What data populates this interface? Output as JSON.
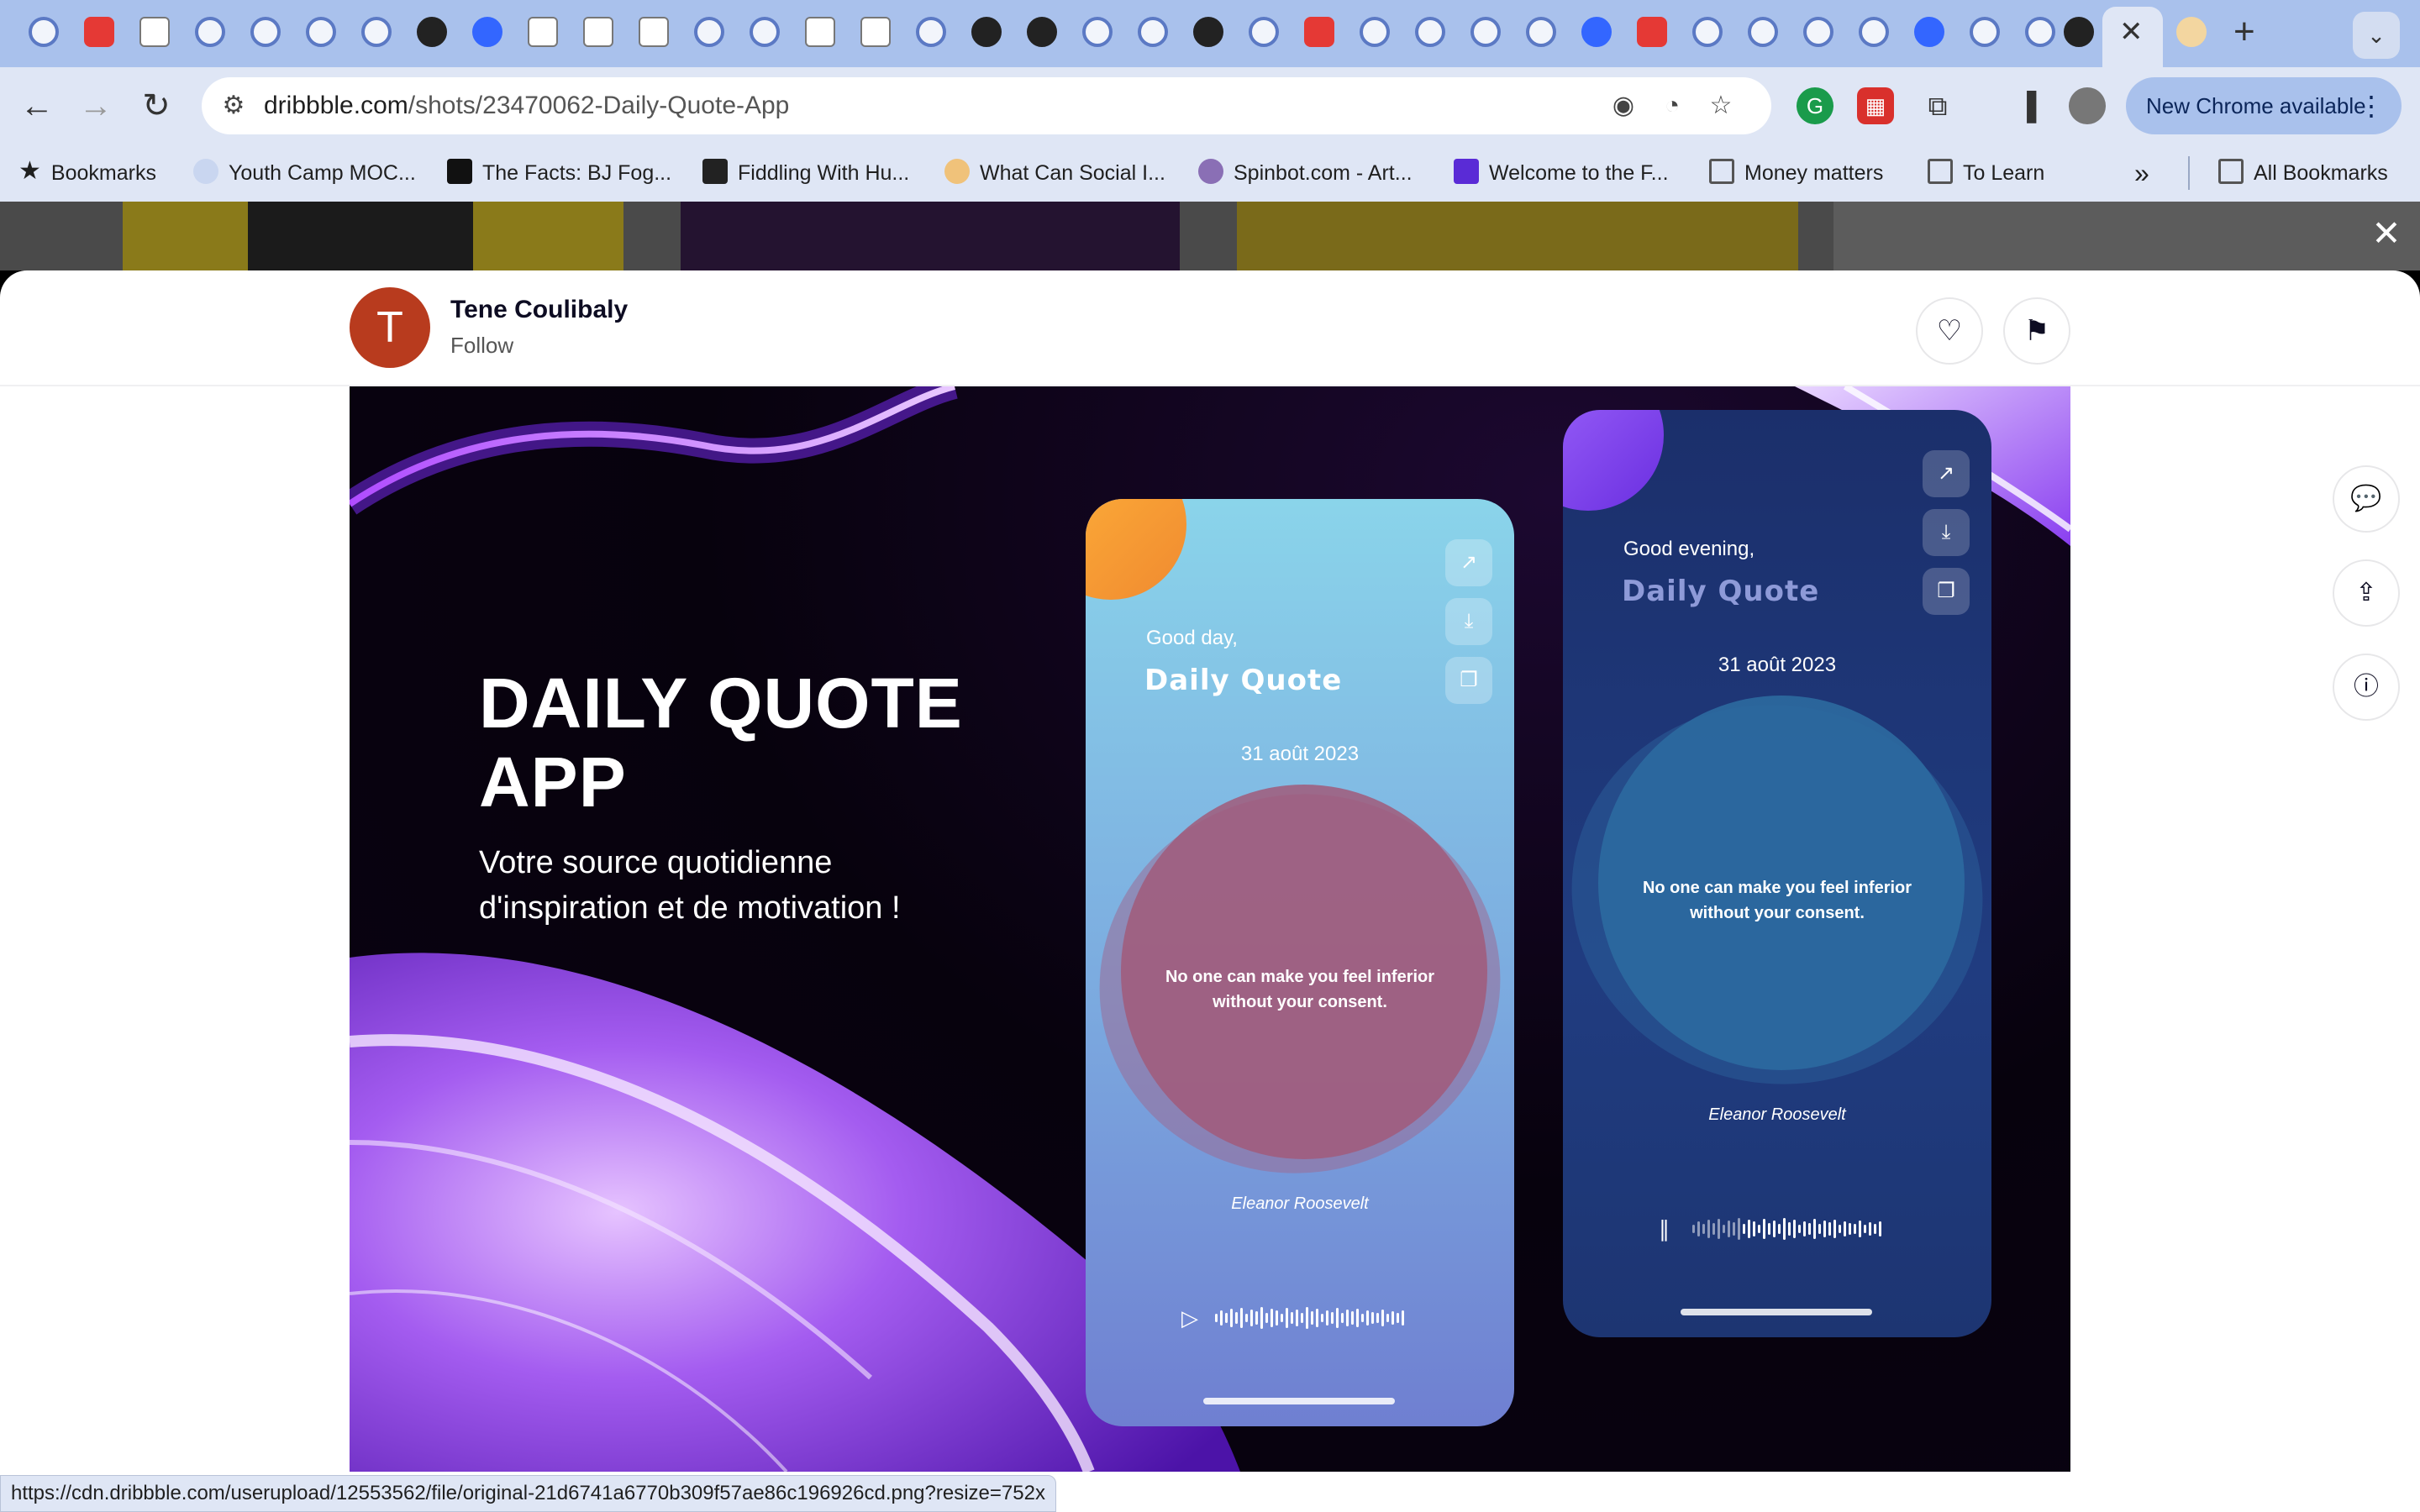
{
  "browser": {
    "url_domain": "dribbble.com",
    "url_path": "/shots/23470062-Daily-Quote-App",
    "update_label": "New Chrome available",
    "bookmarks": [
      {
        "label": "Bookmarks",
        "icon": "star-icon"
      },
      {
        "label": "Youth Camp MOC...",
        "icon": "site-favicon"
      },
      {
        "label": "The Facts: BJ Fog...",
        "icon": "medium-favicon"
      },
      {
        "label": "Fiddling With Hu...",
        "icon": "site-favicon"
      },
      {
        "label": "What Can Social I...",
        "icon": "site-favicon"
      },
      {
        "label": "Spinbot.com - Art...",
        "icon": "site-favicon"
      },
      {
        "label": "Welcome to the F...",
        "icon": "site-favicon"
      },
      {
        "label": "Money matters",
        "icon": "folder-icon"
      },
      {
        "label": "To Learn",
        "icon": "folder-icon"
      },
      {
        "label": "All Bookmarks",
        "icon": "folder-icon"
      }
    ],
    "status_url": "https://cdn.dribbble.com/userupload/12553562/file/original-21d6741a6770b309f57ae86c196926cd.png?resize=752x"
  },
  "shot": {
    "author_initial": "T",
    "author_name": "Tene Coulibaly",
    "follow_label": "Follow",
    "headline_line1": "DAILY QUOTE",
    "headline_line2": "APP",
    "subhead_line1": "Votre source quotidienne",
    "subhead_line2": "d'inspiration et de motivation !",
    "phone_light": {
      "greeting": "Good day,",
      "app_name": "Daily Quote",
      "date": "31 août 2023",
      "quote": "No one can make you feel inferior without your consent.",
      "author": "Eleanor Roosevelt"
    },
    "phone_dark": {
      "greeting": "Good evening,",
      "app_name": "Daily Quote",
      "date": "31 août 2023",
      "quote": "No one can make you feel inferior without your consent.",
      "author": "Eleanor Roosevelt"
    }
  },
  "colors": {
    "accent_purple": "#8a3ff0",
    "avatar": "#b83b1e",
    "phone_light_top": "#86d0e8",
    "phone_light_bottom": "#6f7fd1",
    "phone_dark": "#1d3a7a",
    "blob_pink": "#a15a7a",
    "blob_blue": "#2c6aa0"
  }
}
